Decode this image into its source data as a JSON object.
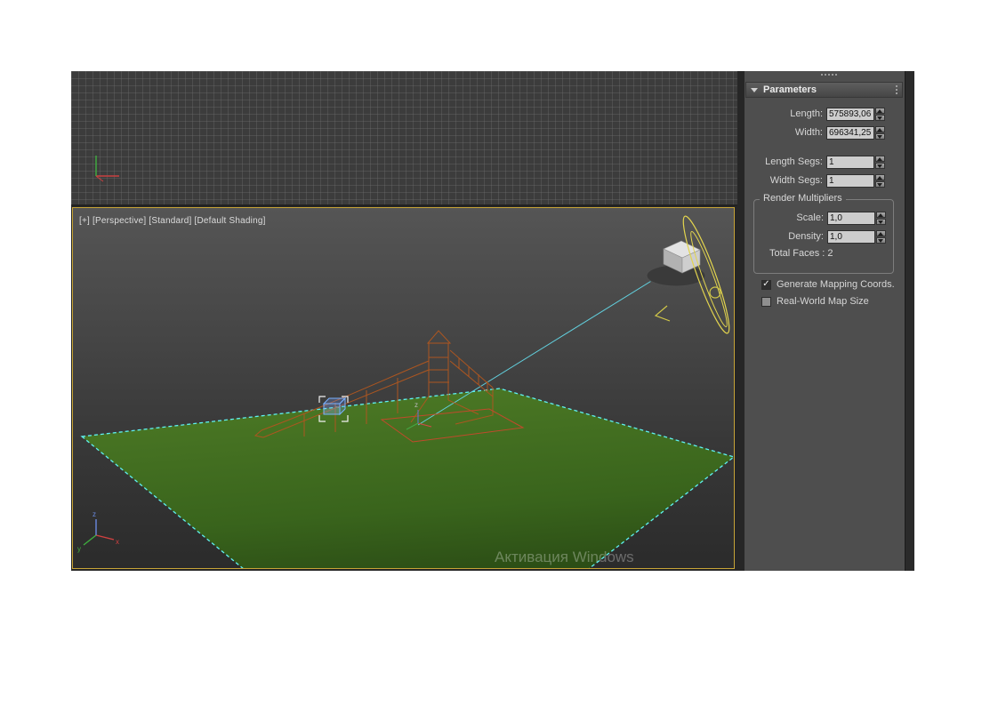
{
  "viewport": {
    "label": "[+] [Perspective] [Standard] [Default Shading]",
    "watermark": "Активация Windows",
    "axis_x": "x",
    "axis_y": "y",
    "axis_z": "z"
  },
  "panel": {
    "rollout_title": "Parameters",
    "params": [
      {
        "label": "Length:",
        "value": "575893,06"
      },
      {
        "label": "Width:",
        "value": "696341,25"
      },
      {
        "label": "Length Segs:",
        "value": "1"
      },
      {
        "label": "Width Segs:",
        "value": "1"
      }
    ],
    "render_multipliers": {
      "title": "Render Multipliers",
      "rows": [
        {
          "label": "Scale:",
          "value": "1,0"
        },
        {
          "label": "Density:",
          "value": "1,0"
        }
      ],
      "total_faces": "Total Faces : 2"
    },
    "checkboxes": [
      {
        "label": "Generate Mapping Coords.",
        "checked": true,
        "glyph": "✓"
      },
      {
        "label": "Real-World Map Size",
        "checked": false,
        "glyph": ""
      }
    ]
  },
  "colors": {
    "active_viewport_border": "#c7a437",
    "selection_outline": "#5ff2f2",
    "object_wireframe": "#ad5620",
    "gizmo_yellow": "#e2d44e",
    "grass_light": "#4e7b26",
    "grass_dark": "#16290b"
  }
}
